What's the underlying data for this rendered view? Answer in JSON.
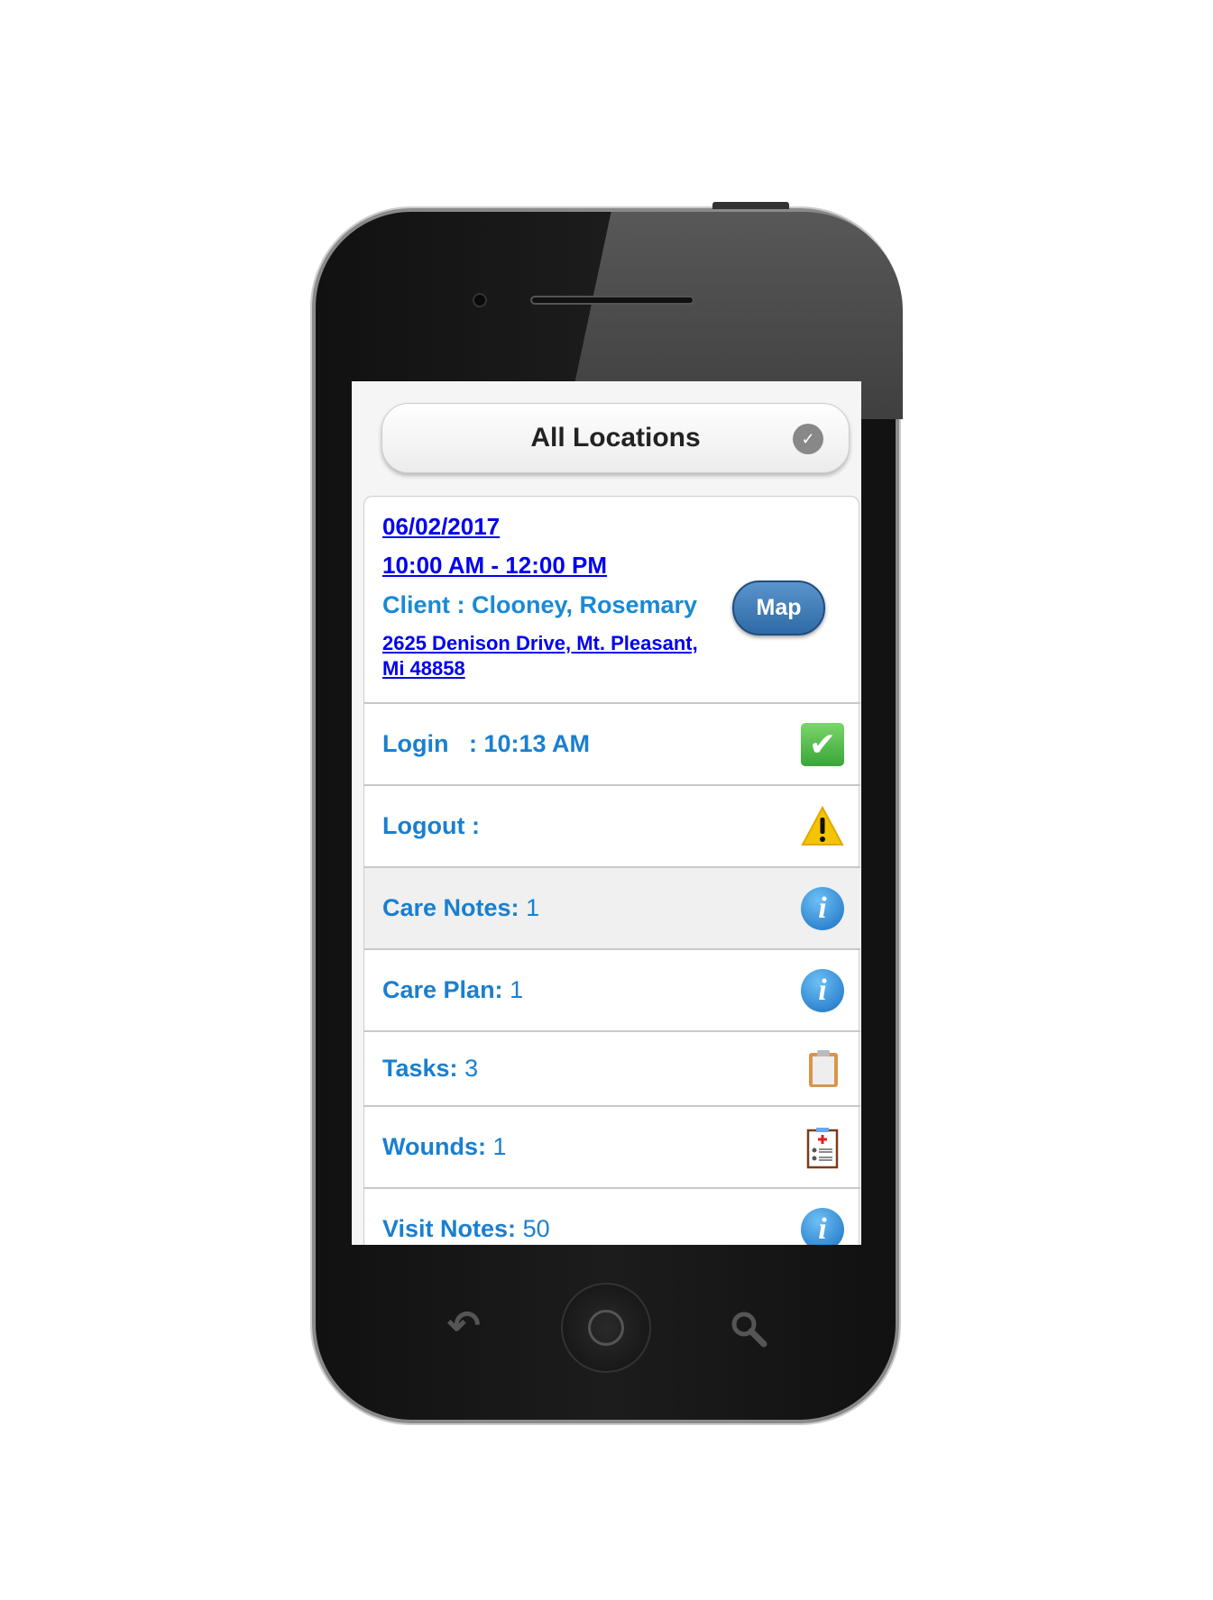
{
  "dropdown": {
    "label": "All Locations",
    "icon": "chevron-down-icon"
  },
  "visit": {
    "date": "06/02/2017",
    "time": "10:00 AM - 12:00 PM",
    "client": "Client : Clooney, Rosemary",
    "address_line1": "2625 Denison Drive, Mt. Pleasant,",
    "address_line2": "Mi 48858",
    "map_label": "Map"
  },
  "rows": [
    {
      "label": "Login   : 10:13 AM",
      "value": "",
      "icon": "checkmark-icon"
    },
    {
      "label": "Logout :",
      "value": "",
      "icon": "warning-icon"
    },
    {
      "label": "Care Notes:",
      "value": "1",
      "icon": "info-icon"
    },
    {
      "label": "Care Plan:",
      "value": "1",
      "icon": "info-icon"
    },
    {
      "label": "Tasks:",
      "value": "3",
      "icon": "clipboard-icon"
    },
    {
      "label": "Wounds:",
      "value": "1",
      "icon": "medical-clipboard-icon"
    },
    {
      "label": "Visit Notes:",
      "value": "50",
      "icon": "info-icon"
    }
  ],
  "colors": {
    "link": "#0000ee",
    "label": "#1a7fcf",
    "map_button": "#3a78b5",
    "check": "#4cb848",
    "warning": "#f5c400"
  }
}
